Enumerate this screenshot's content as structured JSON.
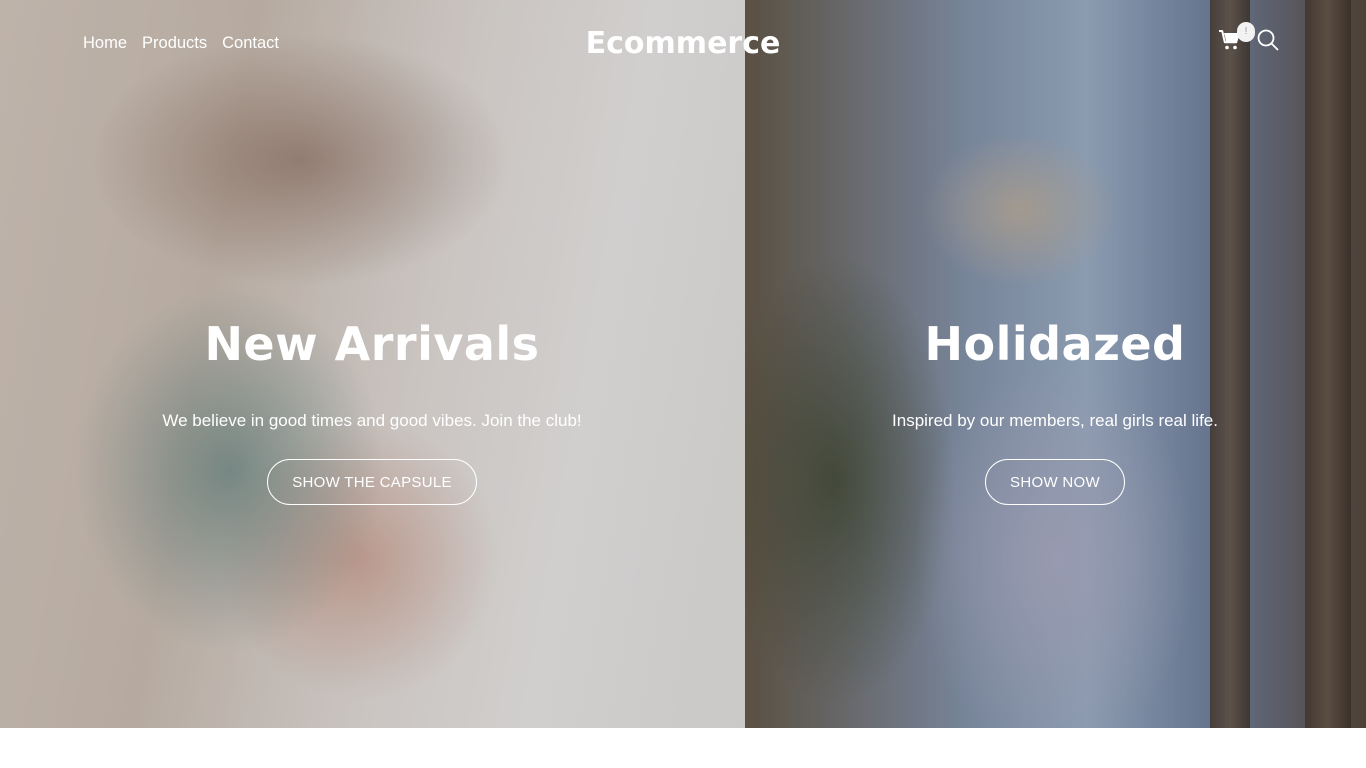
{
  "header": {
    "brand": "Ecommerce",
    "nav": [
      {
        "label": "Home"
      },
      {
        "label": "Products"
      },
      {
        "label": "Contact"
      }
    ],
    "cart": {
      "icon": "cart-icon",
      "badge": "!"
    },
    "search": {
      "icon": "search-icon"
    }
  },
  "hero_left": {
    "title": "New Arrivals",
    "subtitle": "We believe in good times and good vibes. Join the club!",
    "button": "SHOW THE CAPSULE"
  },
  "hero_right": {
    "title": "Holidazed",
    "subtitle": "Inspired by our members, real girls real life.",
    "button": "SHOW NOW"
  },
  "colors": {
    "text": "#ffffff",
    "background": "#ffffff"
  }
}
